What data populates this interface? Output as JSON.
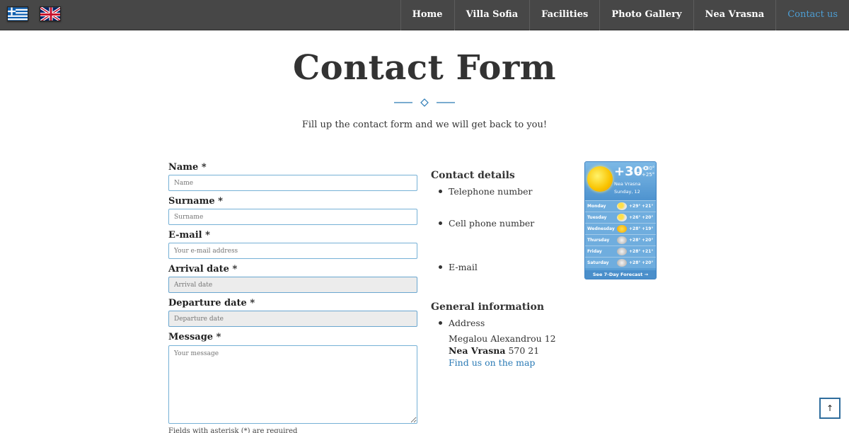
{
  "nav": {
    "flags": [
      {
        "name": "greek-flag-icon",
        "lang": "Greek"
      },
      {
        "name": "uk-flag-icon",
        "lang": "English"
      }
    ],
    "items": [
      {
        "label": "Home",
        "active": false
      },
      {
        "label": "Villa Sofia",
        "active": false
      },
      {
        "label": "Facilities",
        "active": false
      },
      {
        "label": "Photo Gallery",
        "active": false
      },
      {
        "label": "Nea Vrasna",
        "active": false
      },
      {
        "label": "Contact us",
        "active": true
      }
    ]
  },
  "header": {
    "title": "Contact Form",
    "subtitle": "Fill up the contact form and we will get back to you!"
  },
  "form": {
    "fields": [
      {
        "label": "Name *",
        "placeholder": "Name",
        "value": ""
      },
      {
        "label": "Surname *",
        "placeholder": "Surname",
        "value": ""
      },
      {
        "label": "E-mail *",
        "placeholder": "Your e-mail address",
        "value": ""
      },
      {
        "label": "Arrival date *",
        "placeholder": "Arrival date",
        "value": ""
      },
      {
        "label": "Departure date *",
        "placeholder": "Departure date",
        "value": ""
      },
      {
        "label": "Message *",
        "placeholder": "Your message",
        "value": ""
      }
    ],
    "note": "Fields with asterisk (*) are required"
  },
  "contact": {
    "title": "Contact details",
    "items": [
      "Telephone number",
      "Cell phone number",
      "E-mail"
    ]
  },
  "general": {
    "title": "General information",
    "address_label": "Address",
    "street": "Megalou Alexandrou 12",
    "city": "Nea Vrasna",
    "postcode": "570 21",
    "map_link": "Find us on the map"
  },
  "weather": {
    "temp": "+30°",
    "unit": "C",
    "high": "+30°",
    "low": "+25°",
    "place": "Nea Vrasna",
    "date": "Sunday, 12",
    "days": [
      {
        "day": "Monday",
        "icon": "partly-sunny-icon",
        "high": "+29°",
        "low": "+21°"
      },
      {
        "day": "Tuesday",
        "icon": "partly-sunny-icon",
        "high": "+26°",
        "low": "+20°"
      },
      {
        "day": "Wednesday",
        "icon": "sun-icon",
        "high": "+28°",
        "low": "+19°"
      },
      {
        "day": "Thursday",
        "icon": "cloud-icon",
        "high": "+28°",
        "low": "+20°"
      },
      {
        "day": "Friday",
        "icon": "cloud-icon",
        "high": "+28°",
        "low": "+21°"
      },
      {
        "day": "Saturday",
        "icon": "cloud-icon",
        "high": "+28°",
        "low": "+20°"
      }
    ],
    "footer": "See 7-Day Forecast →"
  },
  "to_top": {
    "icon": "arrow-up-icon",
    "glyph": "↑"
  },
  "colors": {
    "navbar": "#474747",
    "accent": "#4d9ed4",
    "link": "#2a7ab5",
    "field_border": "#76b1d6"
  }
}
